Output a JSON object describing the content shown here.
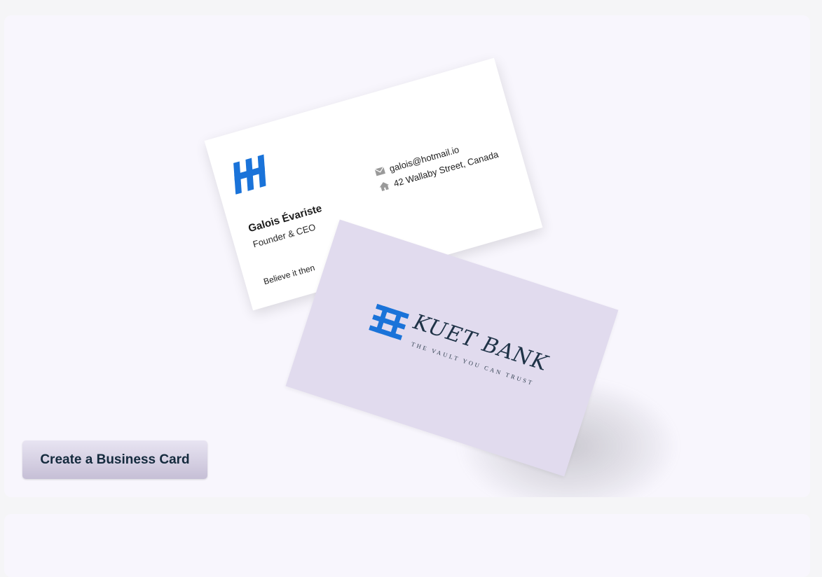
{
  "front_card": {
    "name": "Galois Évariste",
    "role": "Founder & CEO",
    "email": "galois@hotmail.io",
    "address": "42 Wallaby Street, Canada",
    "tagline": "Believe it then",
    "logo_color": "#1a73d9"
  },
  "back_card": {
    "bank_name": "KUET BANK",
    "bank_tagline": "THE VAULT YOU CAN TRUST",
    "logo_color": "#1a73d9",
    "card_color": "#e1dbee"
  },
  "actions": {
    "create_label": "Create a Business Card"
  },
  "icons": {
    "email": "envelope-icon",
    "address": "home-icon"
  }
}
